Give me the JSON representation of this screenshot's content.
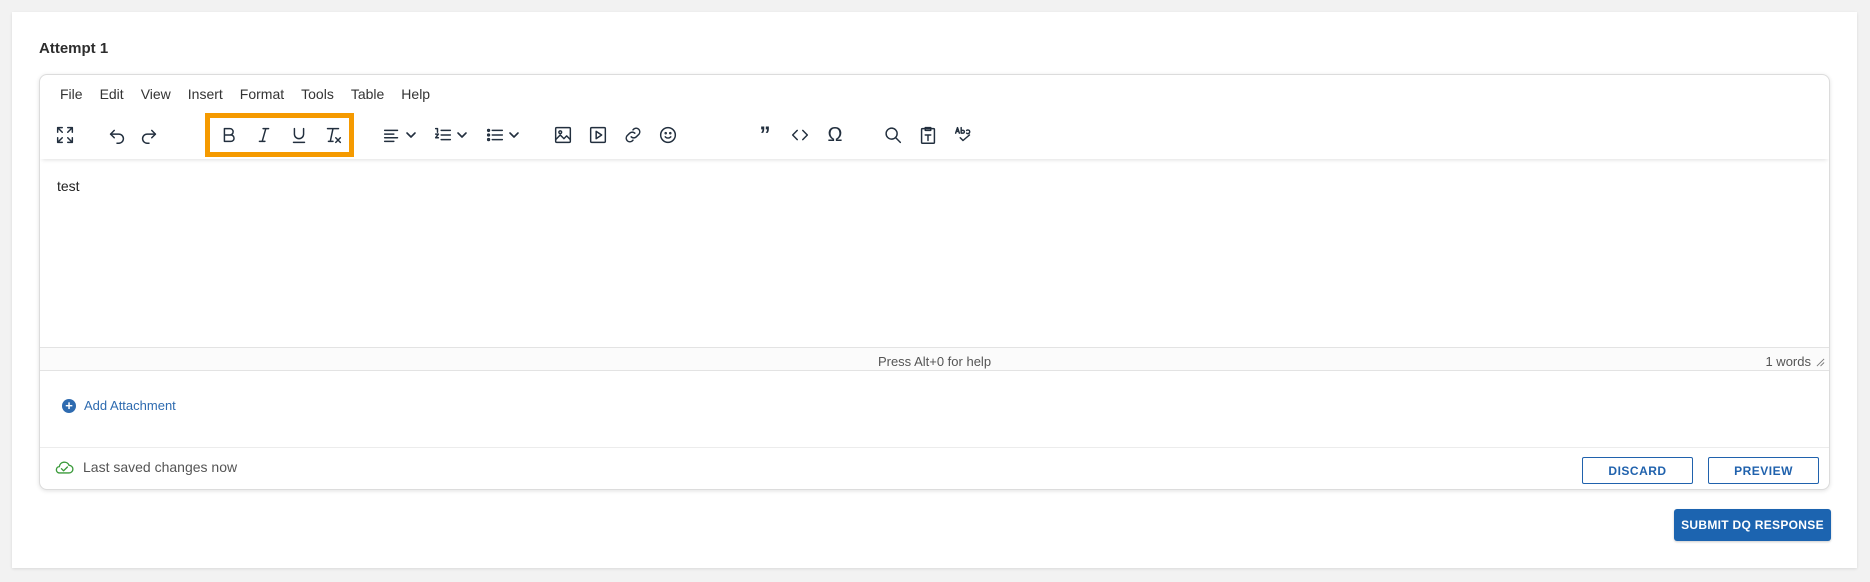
{
  "attempt": {
    "title": "Attempt 1"
  },
  "editor": {
    "menu": [
      "File",
      "Edit",
      "View",
      "Insert",
      "Format",
      "Tools",
      "Table",
      "Help"
    ],
    "toolbar_icons": [
      "fullscreen-icon",
      "undo-icon",
      "redo-icon",
      "bold-icon",
      "italic-icon",
      "underline-icon",
      "clear-formatting-icon",
      "align-icon",
      "numbered-list-icon",
      "bullet-list-icon",
      "image-icon",
      "media-icon",
      "link-icon",
      "emoji-icon",
      "blockquote-icon",
      "code-icon",
      "special-character-icon",
      "search-replace-icon",
      "paste-text-icon",
      "spellcheck-icon"
    ],
    "content": "test",
    "status_help": "Press Alt+0 for help",
    "word_count": "1 words"
  },
  "attachment": {
    "label": "Add Attachment"
  },
  "footer": {
    "saved_text": "Last saved changes now",
    "discard_label": "DISCARD",
    "preview_label": "PREVIEW"
  },
  "submit": {
    "label": "SUBMIT DQ RESPONSE"
  },
  "colors": {
    "highlight": "#f59a00",
    "primary": "#1c64b0",
    "saved_green": "#3a9a3a"
  }
}
